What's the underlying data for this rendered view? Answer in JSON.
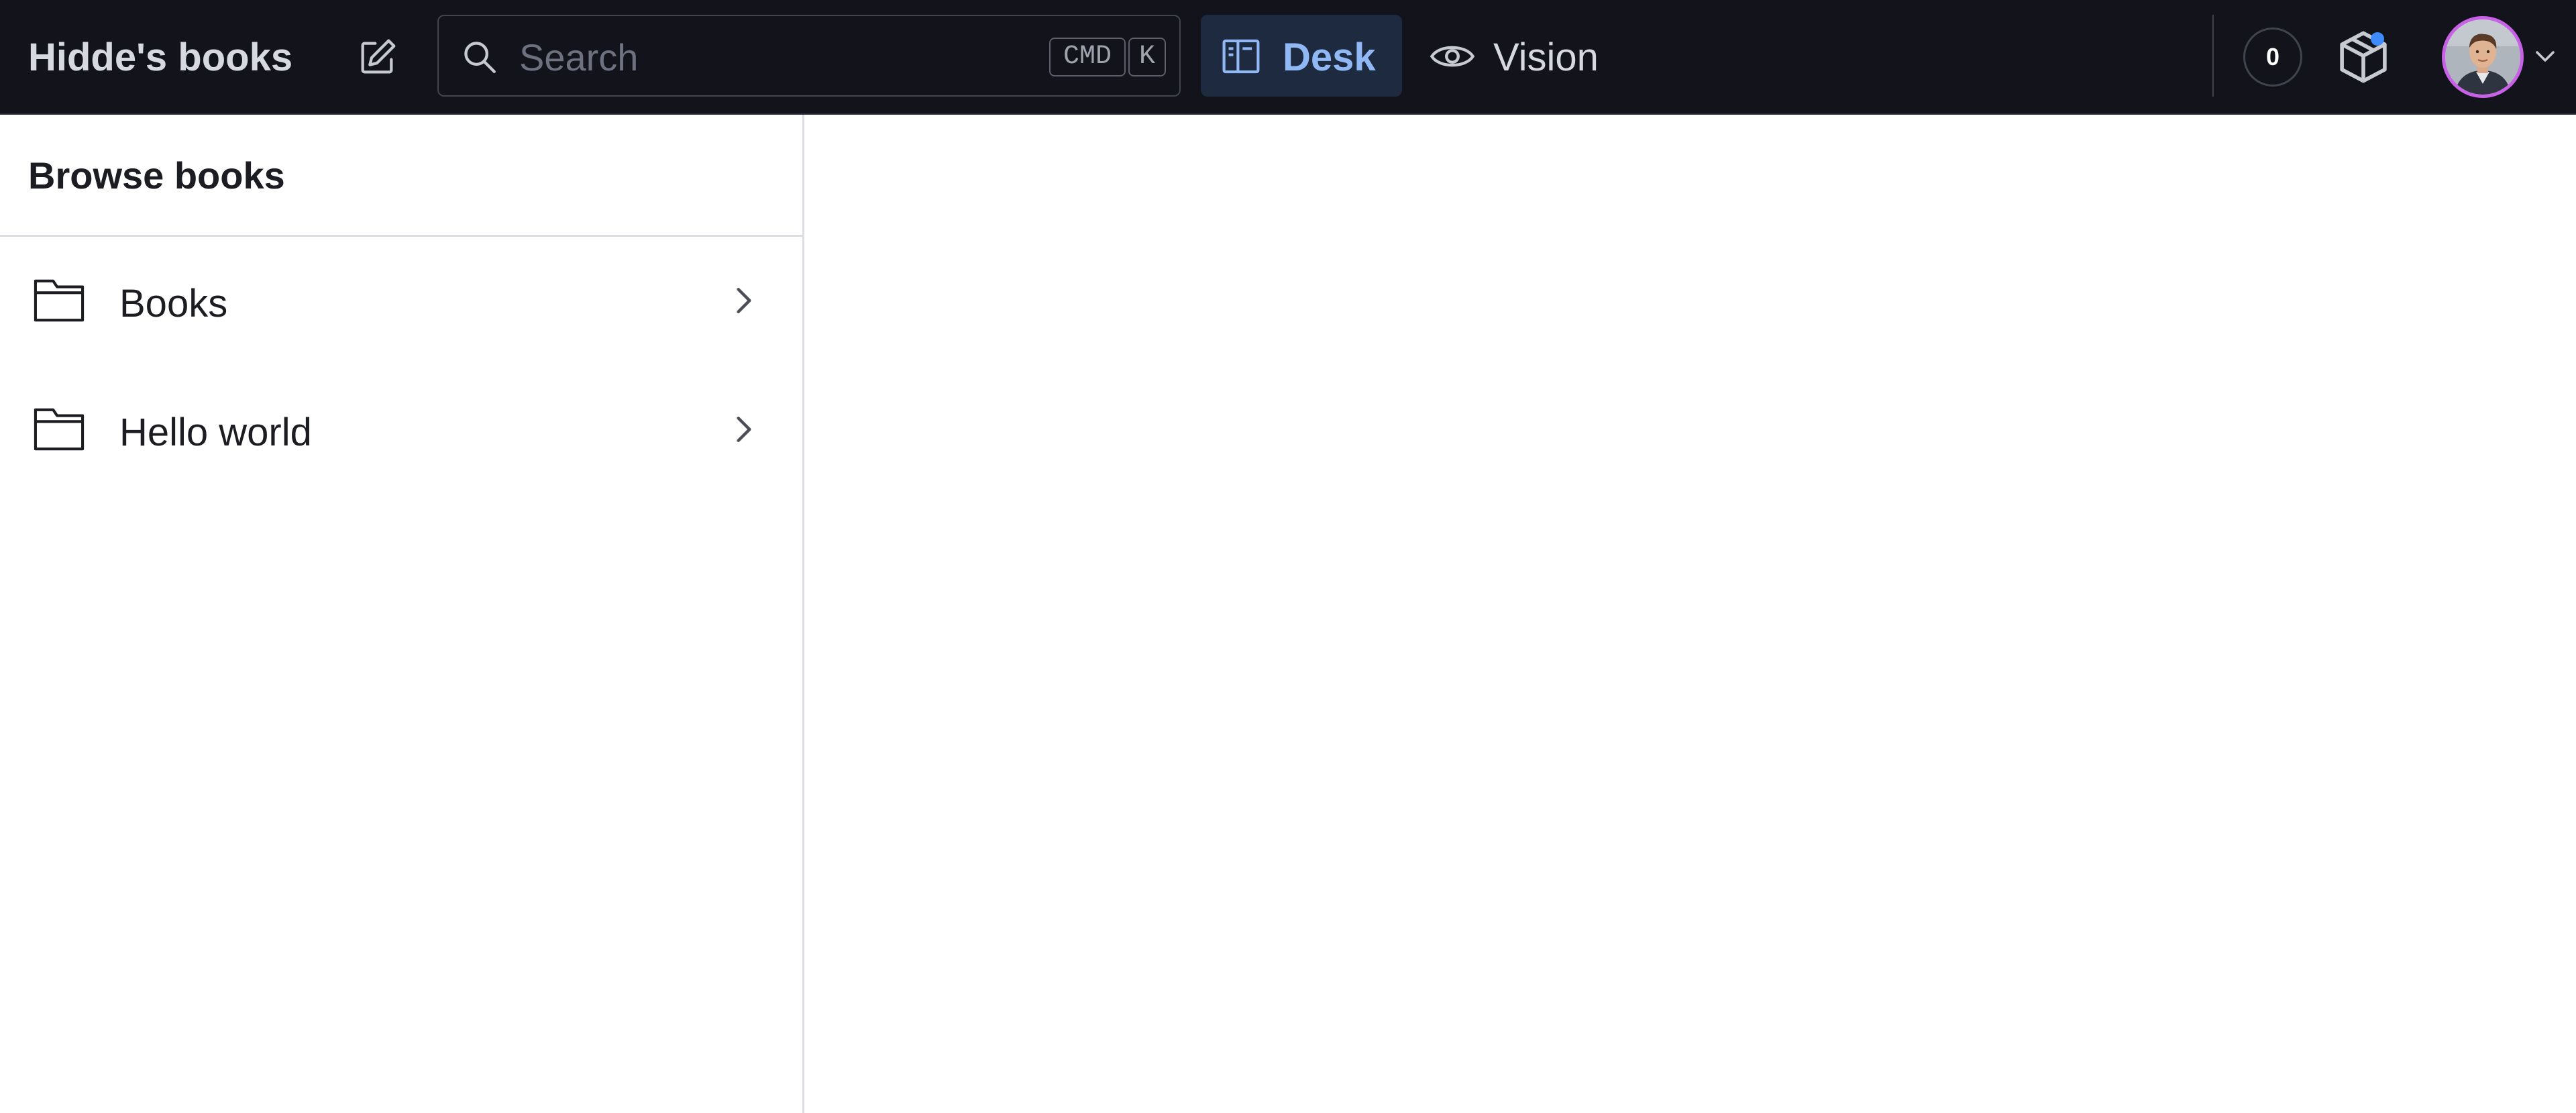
{
  "header": {
    "app_title": "Hidde's books",
    "search": {
      "placeholder": "Search",
      "shortcut_keys": [
        "CMD",
        "K"
      ]
    },
    "tools": [
      {
        "label": "Desk",
        "icon": "desk-icon",
        "active": true
      },
      {
        "label": "Vision",
        "icon": "eye-icon",
        "active": false
      }
    ],
    "status_count": "0",
    "icons": {
      "compose": "compose-icon",
      "search": "search-icon",
      "package": "package-icon",
      "avatar_menu": "chevron-down-icon"
    },
    "colors": {
      "topbar_bg": "#13141b",
      "active_tool_bg": "#1e2a40",
      "active_tool_text": "#8fb8f5",
      "notification_dot": "#3d8bfd",
      "avatar_ring": "#c961e8"
    }
  },
  "sidebar": {
    "title": "Browse books",
    "items": [
      {
        "label": "Books",
        "icon": "folder-icon"
      },
      {
        "label": "Hello world",
        "icon": "folder-icon"
      }
    ]
  }
}
